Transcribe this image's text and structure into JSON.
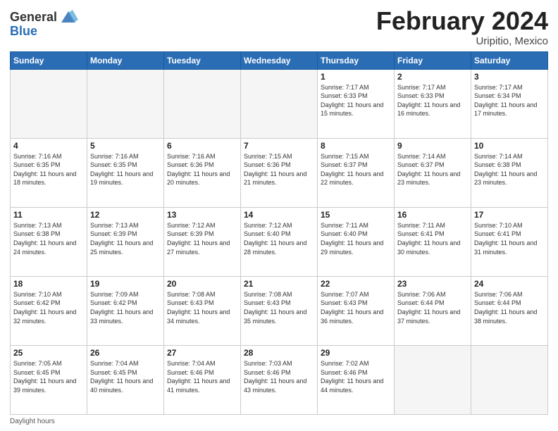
{
  "header": {
    "logo_general": "General",
    "logo_blue": "Blue",
    "month_title": "February 2024",
    "subtitle": "Uripitio, Mexico"
  },
  "days_of_week": [
    "Sunday",
    "Monday",
    "Tuesday",
    "Wednesday",
    "Thursday",
    "Friday",
    "Saturday"
  ],
  "footer": {
    "daylight_label": "Daylight hours"
  },
  "weeks": [
    [
      {
        "day": "",
        "info": ""
      },
      {
        "day": "",
        "info": ""
      },
      {
        "day": "",
        "info": ""
      },
      {
        "day": "",
        "info": ""
      },
      {
        "day": "1",
        "info": "Sunrise: 7:17 AM\nSunset: 6:33 PM\nDaylight: 11 hours and 15 minutes."
      },
      {
        "day": "2",
        "info": "Sunrise: 7:17 AM\nSunset: 6:33 PM\nDaylight: 11 hours and 16 minutes."
      },
      {
        "day": "3",
        "info": "Sunrise: 7:17 AM\nSunset: 6:34 PM\nDaylight: 11 hours and 17 minutes."
      }
    ],
    [
      {
        "day": "4",
        "info": "Sunrise: 7:16 AM\nSunset: 6:35 PM\nDaylight: 11 hours and 18 minutes."
      },
      {
        "day": "5",
        "info": "Sunrise: 7:16 AM\nSunset: 6:35 PM\nDaylight: 11 hours and 19 minutes."
      },
      {
        "day": "6",
        "info": "Sunrise: 7:16 AM\nSunset: 6:36 PM\nDaylight: 11 hours and 20 minutes."
      },
      {
        "day": "7",
        "info": "Sunrise: 7:15 AM\nSunset: 6:36 PM\nDaylight: 11 hours and 21 minutes."
      },
      {
        "day": "8",
        "info": "Sunrise: 7:15 AM\nSunset: 6:37 PM\nDaylight: 11 hours and 22 minutes."
      },
      {
        "day": "9",
        "info": "Sunrise: 7:14 AM\nSunset: 6:37 PM\nDaylight: 11 hours and 23 minutes."
      },
      {
        "day": "10",
        "info": "Sunrise: 7:14 AM\nSunset: 6:38 PM\nDaylight: 11 hours and 23 minutes."
      }
    ],
    [
      {
        "day": "11",
        "info": "Sunrise: 7:13 AM\nSunset: 6:38 PM\nDaylight: 11 hours and 24 minutes."
      },
      {
        "day": "12",
        "info": "Sunrise: 7:13 AM\nSunset: 6:39 PM\nDaylight: 11 hours and 25 minutes."
      },
      {
        "day": "13",
        "info": "Sunrise: 7:12 AM\nSunset: 6:39 PM\nDaylight: 11 hours and 27 minutes."
      },
      {
        "day": "14",
        "info": "Sunrise: 7:12 AM\nSunset: 6:40 PM\nDaylight: 11 hours and 28 minutes."
      },
      {
        "day": "15",
        "info": "Sunrise: 7:11 AM\nSunset: 6:40 PM\nDaylight: 11 hours and 29 minutes."
      },
      {
        "day": "16",
        "info": "Sunrise: 7:11 AM\nSunset: 6:41 PM\nDaylight: 11 hours and 30 minutes."
      },
      {
        "day": "17",
        "info": "Sunrise: 7:10 AM\nSunset: 6:41 PM\nDaylight: 11 hours and 31 minutes."
      }
    ],
    [
      {
        "day": "18",
        "info": "Sunrise: 7:10 AM\nSunset: 6:42 PM\nDaylight: 11 hours and 32 minutes."
      },
      {
        "day": "19",
        "info": "Sunrise: 7:09 AM\nSunset: 6:42 PM\nDaylight: 11 hours and 33 minutes."
      },
      {
        "day": "20",
        "info": "Sunrise: 7:08 AM\nSunset: 6:43 PM\nDaylight: 11 hours and 34 minutes."
      },
      {
        "day": "21",
        "info": "Sunrise: 7:08 AM\nSunset: 6:43 PM\nDaylight: 11 hours and 35 minutes."
      },
      {
        "day": "22",
        "info": "Sunrise: 7:07 AM\nSunset: 6:43 PM\nDaylight: 11 hours and 36 minutes."
      },
      {
        "day": "23",
        "info": "Sunrise: 7:06 AM\nSunset: 6:44 PM\nDaylight: 11 hours and 37 minutes."
      },
      {
        "day": "24",
        "info": "Sunrise: 7:06 AM\nSunset: 6:44 PM\nDaylight: 11 hours and 38 minutes."
      }
    ],
    [
      {
        "day": "25",
        "info": "Sunrise: 7:05 AM\nSunset: 6:45 PM\nDaylight: 11 hours and 39 minutes."
      },
      {
        "day": "26",
        "info": "Sunrise: 7:04 AM\nSunset: 6:45 PM\nDaylight: 11 hours and 40 minutes."
      },
      {
        "day": "27",
        "info": "Sunrise: 7:04 AM\nSunset: 6:46 PM\nDaylight: 11 hours and 41 minutes."
      },
      {
        "day": "28",
        "info": "Sunrise: 7:03 AM\nSunset: 6:46 PM\nDaylight: 11 hours and 43 minutes."
      },
      {
        "day": "29",
        "info": "Sunrise: 7:02 AM\nSunset: 6:46 PM\nDaylight: 11 hours and 44 minutes."
      },
      {
        "day": "",
        "info": ""
      },
      {
        "day": "",
        "info": ""
      }
    ]
  ]
}
